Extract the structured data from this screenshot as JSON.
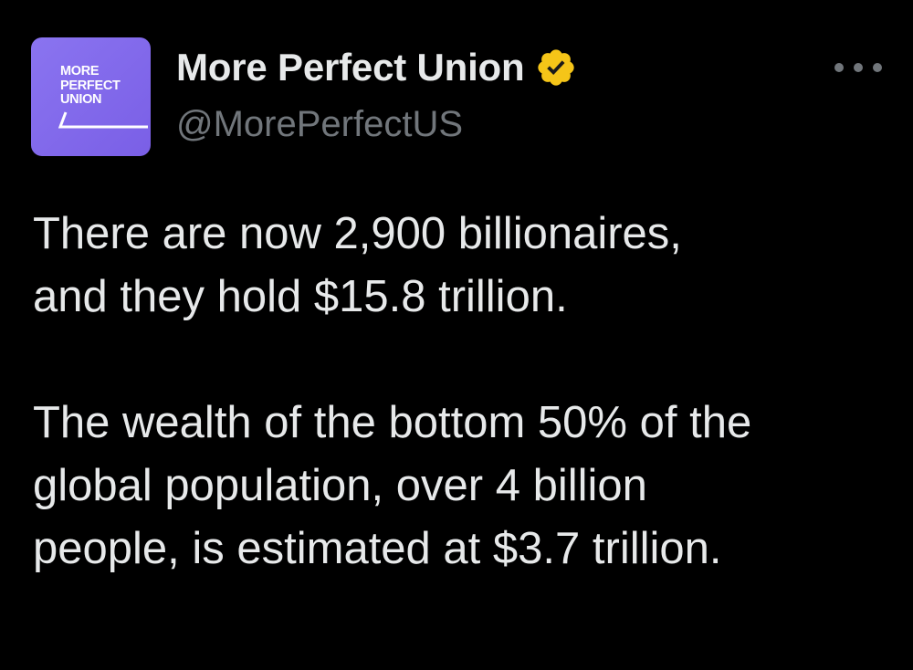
{
  "tweet": {
    "author": {
      "display_name": "More Perfect Union",
      "handle": "@MorePerfectUS",
      "verified_icon": "verified-badge-icon",
      "verified_color": "#f5c518",
      "avatar": {
        "logo_lines": [
          "MORE",
          "PERFECT",
          "UNION"
        ],
        "background": "#7c64ea"
      }
    },
    "more_icon": "more-options-icon",
    "paragraphs": {
      "p1_line1": "There are now 2,900 billionaires,",
      "p1_line2": "and they hold $15.8 trillion.",
      "p2_line1": "The wealth of the bottom 50% of the",
      "p2_line2": "global population, over 4 billion",
      "p2_line3": "people, is estimated at $3.7 trillion."
    }
  }
}
